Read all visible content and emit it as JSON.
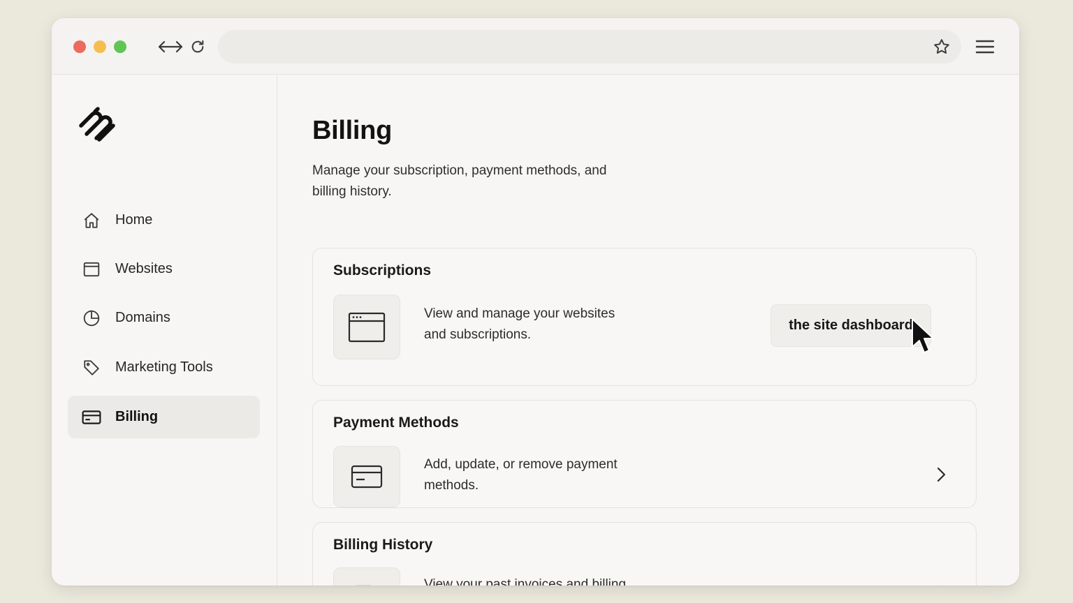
{
  "sidebar": {
    "items": [
      {
        "label": "Home",
        "icon": "home-icon"
      },
      {
        "label": "Websites",
        "icon": "browser-window-icon"
      },
      {
        "label": "Domains",
        "icon": "pie-chart-icon"
      },
      {
        "label": "Marketing Tools",
        "icon": "tag-icon"
      },
      {
        "label": "Billing",
        "icon": "credit-card-icon",
        "active": true
      }
    ]
  },
  "main": {
    "title": "Billing",
    "subtitle": "Manage your subscription, payment methods, and billing history.",
    "cards": [
      {
        "title": "Subscriptions",
        "description": "View and manage your websites and subscriptions.",
        "button_label": "the site dashboard",
        "icon": "browser-window-icon"
      },
      {
        "title": "Payment Methods",
        "description": "Add, update, or remove payment methods.",
        "icon": "credit-card-icon"
      },
      {
        "title": "Billing History",
        "description": "View your past invoices and billing activity.",
        "icon": "document-icon"
      }
    ]
  },
  "colors": {
    "background": "#ebe8dc",
    "window": "#f7f6f4",
    "active_item": "#ebeae7",
    "traffic_red": "#ec6a5e",
    "traffic_yellow": "#f4bf4f",
    "traffic_green": "#61c554"
  }
}
